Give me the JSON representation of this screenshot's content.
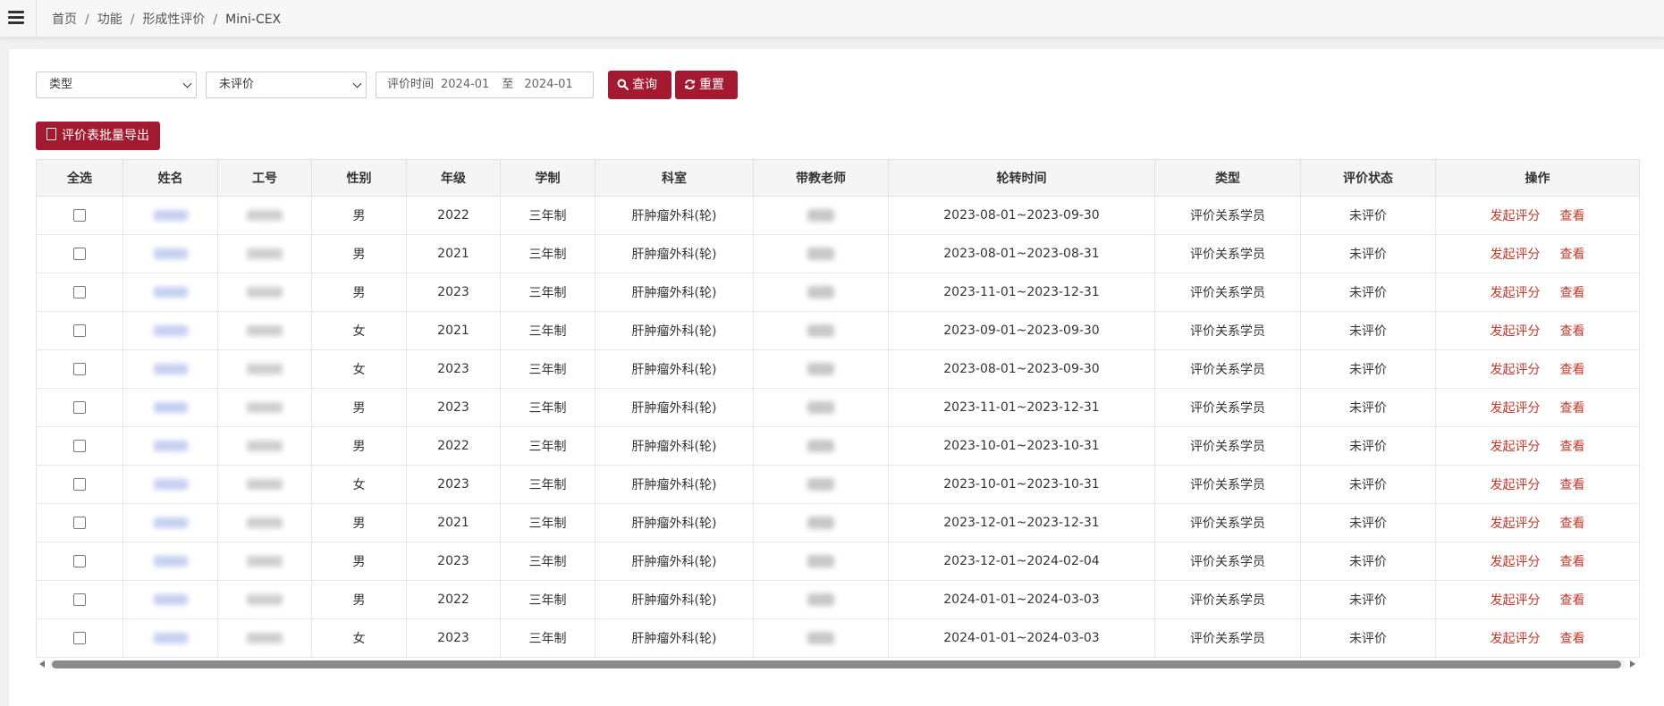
{
  "breadcrumb": [
    "首页",
    "功能",
    "形成性评价",
    "Mini-CEX"
  ],
  "filters": {
    "type_select": "类型",
    "status_select": "未评价",
    "date_label": "评价时间",
    "date_from": "2024-01",
    "date_sep": "至",
    "date_to": "2024-01",
    "query_label": "查询",
    "reset_label": "重置"
  },
  "export_label": "评价表批量导出",
  "table": {
    "headers": [
      "全选",
      "姓名",
      "工号",
      "性别",
      "年级",
      "学制",
      "科室",
      "带教老师",
      "轮转时间",
      "类型",
      "评价状态",
      "操作"
    ],
    "rows": [
      {
        "gender": "男",
        "grade": "2022",
        "system": "三年制",
        "dept": "肝肿瘤外科(轮)",
        "period": "2023-08-01~2023-09-30",
        "type": "评价关系学员",
        "status": "未评价"
      },
      {
        "gender": "男",
        "grade": "2021",
        "system": "三年制",
        "dept": "肝肿瘤外科(轮)",
        "period": "2023-08-01~2023-08-31",
        "type": "评价关系学员",
        "status": "未评价"
      },
      {
        "gender": "男",
        "grade": "2023",
        "system": "三年制",
        "dept": "肝肿瘤外科(轮)",
        "period": "2023-11-01~2023-12-31",
        "type": "评价关系学员",
        "status": "未评价"
      },
      {
        "gender": "女",
        "grade": "2021",
        "system": "三年制",
        "dept": "肝肿瘤外科(轮)",
        "period": "2023-09-01~2023-09-30",
        "type": "评价关系学员",
        "status": "未评价"
      },
      {
        "gender": "女",
        "grade": "2023",
        "system": "三年制",
        "dept": "肝肿瘤外科(轮)",
        "period": "2023-08-01~2023-09-30",
        "type": "评价关系学员",
        "status": "未评价"
      },
      {
        "gender": "男",
        "grade": "2023",
        "system": "三年制",
        "dept": "肝肿瘤外科(轮)",
        "period": "2023-11-01~2023-12-31",
        "type": "评价关系学员",
        "status": "未评价"
      },
      {
        "gender": "男",
        "grade": "2022",
        "system": "三年制",
        "dept": "肝肿瘤外科(轮)",
        "period": "2023-10-01~2023-10-31",
        "type": "评价关系学员",
        "status": "未评价"
      },
      {
        "gender": "女",
        "grade": "2023",
        "system": "三年制",
        "dept": "肝肿瘤外科(轮)",
        "period": "2023-10-01~2023-10-31",
        "type": "评价关系学员",
        "status": "未评价"
      },
      {
        "gender": "男",
        "grade": "2021",
        "system": "三年制",
        "dept": "肝肿瘤外科(轮)",
        "period": "2023-12-01~2023-12-31",
        "type": "评价关系学员",
        "status": "未评价"
      },
      {
        "gender": "男",
        "grade": "2023",
        "system": "三年制",
        "dept": "肝肿瘤外科(轮)",
        "period": "2023-12-01~2024-02-04",
        "type": "评价关系学员",
        "status": "未评价"
      },
      {
        "gender": "男",
        "grade": "2022",
        "system": "三年制",
        "dept": "肝肿瘤外科(轮)",
        "period": "2024-01-01~2024-03-03",
        "type": "评价关系学员",
        "status": "未评价"
      },
      {
        "gender": "女",
        "grade": "2023",
        "system": "三年制",
        "dept": "肝肿瘤外科(轮)",
        "period": "2024-01-01~2024-03-03",
        "type": "评价关系学员",
        "status": "未评价"
      }
    ],
    "action_start": "发起评分",
    "action_view": "查看"
  },
  "colors": {
    "brand": "#a3192f",
    "link": "#c0392b"
  }
}
